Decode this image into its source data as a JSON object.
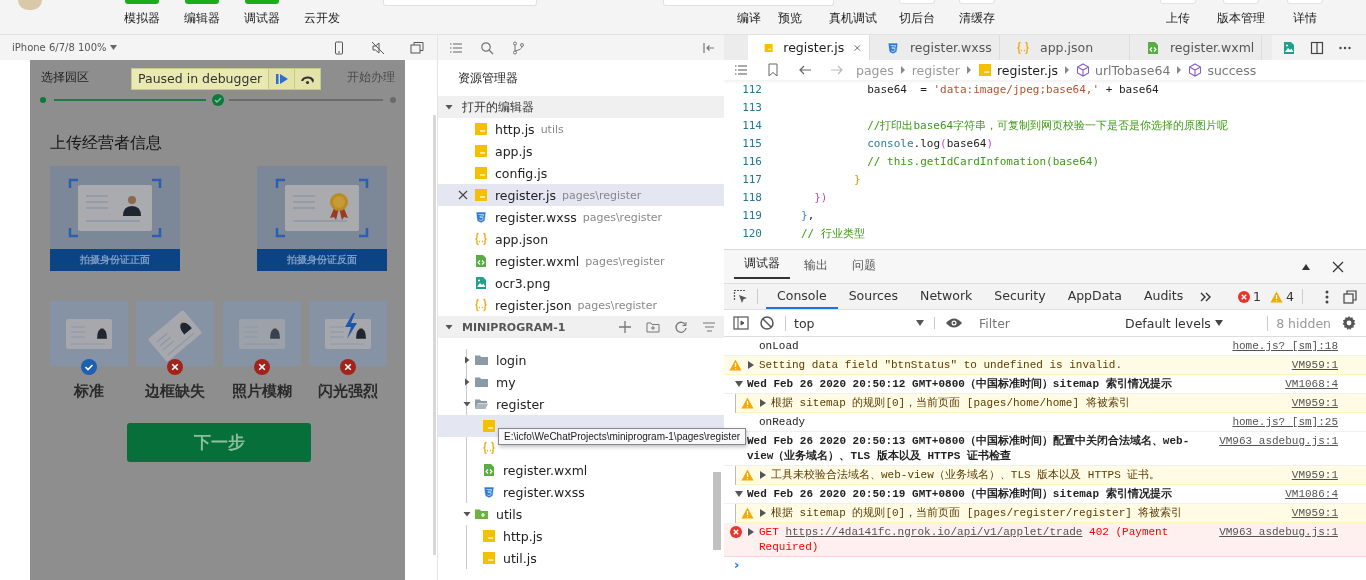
{
  "toolbar": {
    "left": [
      {
        "label": "模拟器",
        "on": true
      },
      {
        "label": "编辑器",
        "on": true
      },
      {
        "label": "调试器",
        "on": true
      },
      {
        "label": "云开发",
        "on": false
      }
    ],
    "center": [
      {
        "label": "编译",
        "kind": "plain"
      },
      {
        "label": "预览",
        "kind": "plain"
      },
      {
        "label": "真机调试",
        "kind": "plain"
      },
      {
        "label": "切后台",
        "kind": "icon"
      },
      {
        "label": "清缓存",
        "kind": "icon"
      }
    ],
    "right": [
      {
        "label": "上传",
        "kind": "icon"
      },
      {
        "label": "版本管理",
        "kind": "icon"
      },
      {
        "label": "详情",
        "kind": "icon"
      }
    ]
  },
  "simulator": {
    "device": "iPhone 6/7/8 100%",
    "banner": "Paused in debugger",
    "steps": [
      {
        "label": "选择园区",
        "done": true,
        "kind": "dot"
      },
      {
        "done": true,
        "kind": "check"
      },
      {
        "label": "开始办理",
        "done": false,
        "kind": "dot"
      }
    ],
    "heading": "上传经营者信息",
    "cards": [
      {
        "caption": "拍摄身份证正面",
        "kind": "portrait"
      },
      {
        "caption": "拍摄身份证反面",
        "kind": "emblem"
      }
    ],
    "samples": [
      {
        "label": "标准",
        "ok": true,
        "kind": "standard"
      },
      {
        "label": "边框缺失",
        "ok": false,
        "kind": "tilted"
      },
      {
        "label": "照片模糊",
        "ok": false,
        "kind": "blurred"
      },
      {
        "label": "闪光强烈",
        "ok": false,
        "kind": "flash"
      }
    ],
    "next_button": "下一步"
  },
  "explorer": {
    "title": "资源管理器",
    "open_editors": {
      "label": "打开的编辑器",
      "expanded": true,
      "items": [
        {
          "name": "http.js",
          "path": "utils",
          "kind": "js",
          "selected": false
        },
        {
          "name": "app.js",
          "kind": "js",
          "selected": false
        },
        {
          "name": "config.js",
          "kind": "js",
          "selected": false
        },
        {
          "name": "register.js",
          "path": "pages\\register",
          "kind": "js",
          "selected": true
        },
        {
          "name": "register.wxss",
          "path": "pages\\register",
          "kind": "wxss",
          "selected": false
        },
        {
          "name": "app.json",
          "kind": "json",
          "selected": false
        },
        {
          "name": "register.wxml",
          "path": "pages\\register",
          "kind": "wxml",
          "selected": false
        },
        {
          "name": "ocr3.png",
          "kind": "png",
          "selected": false
        },
        {
          "name": "register.json",
          "path": "pages\\register",
          "kind": "json",
          "selected": false
        }
      ]
    },
    "project": {
      "label": "MINIPROGRAM-1",
      "expanded": true,
      "tree": [
        {
          "children": [
            {
              "name": "login",
              "kind": "folder",
              "expanded": false,
              "selected": false
            },
            {
              "name": "my",
              "kind": "folder",
              "expanded": false,
              "selected": false
            },
            {
              "name": "register",
              "kind": "folder",
              "expanded": true,
              "selected": false,
              "children": [
                {
                  "kind": "js",
                  "selected": true
                },
                {
                  "kind": "json",
                  "selected": false
                },
                {
                  "name": "register.wxml",
                  "kind": "wxml",
                  "selected": false
                },
                {
                  "name": "register.wxss",
                  "kind": "wxss",
                  "selected": false
                }
              ]
            }
          ]
        },
        {
          "name": "utils",
          "kind": "package",
          "expanded": true,
          "selected": false,
          "children": [
            {
              "name": "http.js",
              "kind": "js",
              "selected": false
            },
            {
              "name": "util.js",
              "kind": "js",
              "selected": false
            }
          ]
        }
      ]
    },
    "tooltip": "E:\\icfo\\WeChatProjects\\miniprogram-1\\pages\\register"
  },
  "editor": {
    "tabs": [
      {
        "name": "register.js",
        "kind": "js",
        "selected": true
      },
      {
        "name": "register.wxss",
        "kind": "wxss",
        "selected": false
      },
      {
        "name": "app.json",
        "kind": "json",
        "selected": false
      },
      {
        "name": "register.wxml",
        "kind": "wxml",
        "selected": false
      }
    ],
    "breadcrumb": [
      {
        "text": "pages",
        "kind": "folder"
      },
      {
        "text": "register",
        "kind": "folder"
      },
      {
        "text": "register.js",
        "kind": "file"
      },
      {
        "text": "urlTobase64",
        "kind": "symbol"
      },
      {
        "text": "success",
        "kind": "symbol"
      }
    ],
    "lines": [
      {
        "number": "112",
        "tokens": [
          {
            "text": "          base64  = ",
            "kind": "plain"
          },
          {
            "text": "'data:image/jpeg;base64,'",
            "kind": "string"
          },
          {
            "text": " + base64",
            "kind": "plain"
          }
        ]
      },
      {
        "number": "113"
      },
      {
        "number": "114",
        "tokens": [
          {
            "text": "          //打印出base64字符串，可复制到网页校验一下是否是你选择的原图片呢",
            "kind": "comment"
          }
        ]
      },
      {
        "number": "115",
        "tokens": [
          {
            "text": "          console",
            "kind": "ident"
          },
          {
            "text": ".log",
            "kind": "plain"
          },
          {
            "text": "(",
            "kind": "bracket2"
          },
          {
            "text": "base64",
            "kind": "plain"
          },
          {
            "text": ")",
            "kind": "bracket2"
          }
        ]
      },
      {
        "number": "116",
        "tokens": [
          {
            "text": "          // this.getIdCardInfomation(base64)",
            "kind": "comment"
          }
        ]
      },
      {
        "number": "117",
        "tokens": [
          {
            "text": "        }",
            "kind": "bracket1"
          }
        ]
      },
      {
        "number": "118",
        "tokens": [
          {
            "text": "  })",
            "kind": "bracket2"
          }
        ]
      },
      {
        "number": "119",
        "tokens": [
          {
            "text": "}",
            "kind": "bracket3"
          },
          {
            "text": ",",
            "kind": "plain"
          }
        ]
      },
      {
        "number": "120",
        "tokens": [
          {
            "text": "// 行业类型",
            "kind": "comment"
          }
        ]
      }
    ]
  },
  "console": {
    "panel_tabs": [
      {
        "label": "调试器",
        "selected": true
      },
      {
        "label": "输出",
        "selected": false
      },
      {
        "label": "问题",
        "selected": false
      }
    ],
    "devtools_tabs": [
      {
        "label": "Console",
        "selected": true
      },
      {
        "label": "Sources",
        "selected": false
      },
      {
        "label": "Network",
        "selected": false
      },
      {
        "label": "Security",
        "selected": false
      },
      {
        "label": "AppData",
        "selected": false
      },
      {
        "label": "Audits",
        "selected": false
      }
    ],
    "error_count": "1",
    "warning_count": "4",
    "context": "top",
    "filter_placeholder": "Filter",
    "levels": "Default levels",
    "hidden_count": "8 hidden",
    "messages": [
      {
        "kind": "log",
        "text": "onLoad",
        "source": "home.js? [sm]:18"
      },
      {
        "kind": "warning",
        "expanded": false,
        "text": "Setting data field \"btnStatus\" to undefined is invalid.",
        "source": "VM959:1"
      },
      {
        "kind": "group",
        "expanded": true,
        "text": "Wed Feb 26 2020 20:50:12 GMT+0800（中国标准时间）sitemap 索引情况提示",
        "source": "VM1068:4",
        "children": [
          {
            "kind": "warning",
            "expanded": false,
            "text": "根据 sitemap 的规则[0]，当前页面 [pages/home/home] 将被索引",
            "source": "VM959:1"
          }
        ]
      },
      {
        "kind": "log",
        "text": "onReady",
        "source": "home.js? [sm]:25"
      },
      {
        "kind": "group",
        "text": "Wed Feb 26 2020 20:50:13 GMT+0800（中国标准时间）配置中关闭合法域名、web-view（业务域名）、TLS 版本以及 HTTPS 证书检查",
        "source": "VM963 asdebug.js:1",
        "children": [
          {
            "kind": "warning",
            "expanded": false,
            "text": "工具未校验合法域名、web-view（业务域名）、TLS 版本以及 HTTPS 证书。",
            "source": "VM959:1"
          }
        ]
      },
      {
        "kind": "group",
        "expanded": true,
        "text": "Wed Feb 26 2020 20:50:19 GMT+0800（中国标准时间）sitemap 索引情况提示",
        "source": "VM1086:4",
        "children": [
          {
            "kind": "warning",
            "expanded": false,
            "text": "根据 sitemap 的规则[0]，当前页面 [pages/register/register] 将被索引",
            "source": "VM959:1"
          }
        ]
      },
      {
        "kind": "error",
        "expanded": false,
        "parts": [
          {
            "text": "GET ",
            "kind": "text"
          },
          {
            "text": "https://4da141fc.ngrok.io/api/v1/applet/trade",
            "kind": "link"
          },
          {
            "text": " 402 (Payment Required)",
            "kind": "text"
          }
        ],
        "source": "VM963 asdebug.js:1"
      }
    ],
    "prompt": "›"
  }
}
